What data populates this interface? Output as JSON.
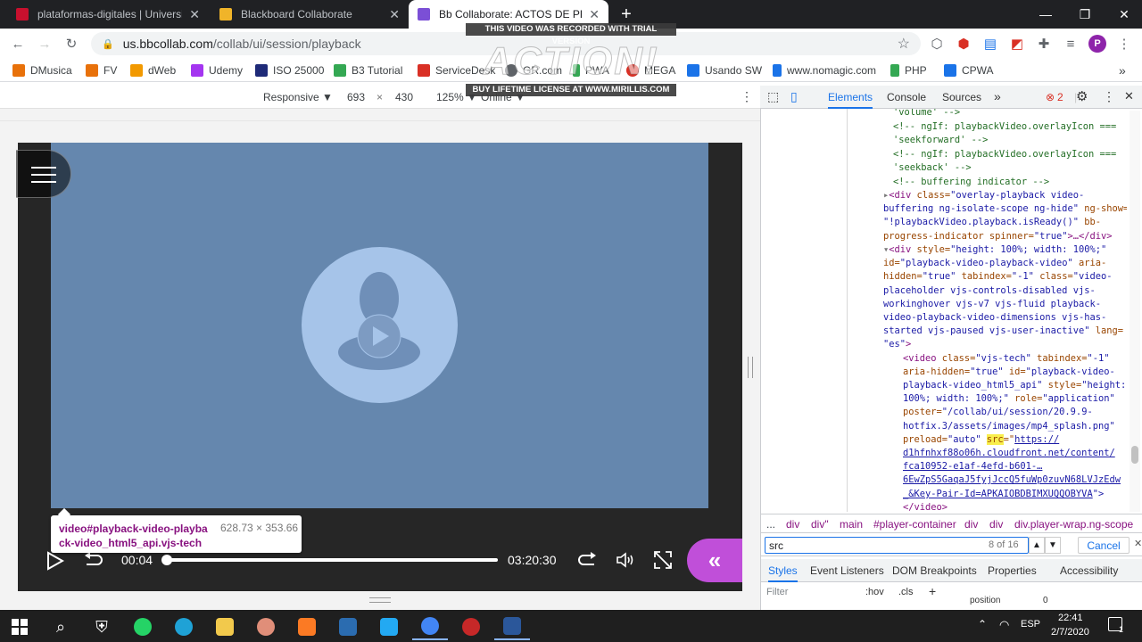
{
  "browser": {
    "tabs": [
      {
        "title": "plataformas-digitales | Universidad",
        "favicon_color": "#c8102e",
        "active": false
      },
      {
        "title": "Blackboard Collaborate",
        "favicon_color": "#f0b429",
        "active": false
      },
      {
        "title": "Bb Collaborate: ACTOS DE PRUEBA",
        "favicon_color": "#7b4fd6",
        "active": true
      }
    ],
    "new_tab": "+",
    "window_controls": {
      "minimize": "—",
      "maximize": "❐",
      "close": "✕"
    },
    "url_host": "us.bbcollab.com",
    "url_path": "/collab/ui/session/playback",
    "profile_initial": "P"
  },
  "bookmarks": [
    {
      "label": "DMusica",
      "color": "#e8710a"
    },
    {
      "label": "FV",
      "color": "#e8710a"
    },
    {
      "label": "dWeb",
      "color": "#f29900"
    },
    {
      "label": "Udemy",
      "color": "#a435f0"
    },
    {
      "label": "ISO 25000",
      "color": "#1e2a78"
    },
    {
      "label": "B3 Tutorial",
      "color": "#34a853"
    },
    {
      "label": "ServiceDesk",
      "color": "#d93025"
    },
    {
      "label": "GR.com",
      "color": "#5f6368"
    },
    {
      "label": "PWA",
      "color": "#34a853"
    },
    {
      "label": "MEGA",
      "color": "#d93025"
    },
    {
      "label": "Usando SW",
      "color": "#1a73e8"
    },
    {
      "label": "www.nomagic.com",
      "color": "#1a73e8"
    },
    {
      "label": "PHP",
      "color": "#34a853"
    },
    {
      "label": "CPWA",
      "color": "#1a73e8"
    }
  ],
  "device_toolbar": {
    "mode": "Responsive ▼",
    "width": "693",
    "times": "×",
    "height": "430",
    "zoom": "125% ▼",
    "network": "Online ▼"
  },
  "player": {
    "time_current": "00:04",
    "time_total": "03:20:30",
    "progress_fraction": 0.0,
    "tooltip_selector": "video#playback-video-playback-video_html5_api.vjs-tech",
    "tooltip_selector_line1": "video#playback-video-playba",
    "tooltip_selector_line2": "ck-video_html5_api.vjs-tech",
    "tooltip_size": "628.73 × 353.66",
    "video_bg_color": "#6587ae",
    "accent_color": "#c04fd9"
  },
  "devtools": {
    "tabs": [
      "Elements",
      "Console",
      "Sources",
      "»"
    ],
    "error_count": "2",
    "breadcrumbs": [
      "...",
      "div",
      "div\"",
      "main",
      "#player-container",
      "div",
      "div",
      "div.player-wrap.ng-scope"
    ],
    "search_value": "src",
    "search_count": "8 of 16",
    "search_cancel": "Cancel",
    "styles_tabs": [
      "Styles",
      "Event Listeners",
      "DOM Breakpoints",
      "Properties",
      "Accessibility"
    ],
    "filter_placeholder": "Filter",
    "filter_hov": ":hov",
    "filter_cls": ".cls",
    "filter_add": "+",
    "computed_prop": "position",
    "computed_value": "0",
    "code": {
      "l1": "'volume' -->",
      "l2": "<!-- ngIf: playbackVideo.overlayIcon ===",
      "l3": "'seekforward' -->",
      "l4": "<!-- ngIf: playbackVideo.overlayIcon ===",
      "l5": "'seekback' -->",
      "l6": "<!-- buffering indicator -->",
      "l7a": "<div",
      "l7b": " class=",
      "l7c": "\"overlay-playback video-",
      "l8": "buffering ng-isolate-scope ng-hide\"",
      "l8b": " ng-show=",
      "l9": "\"!playbackVideo.playback.isReady()\"",
      "l9b": " bb-",
      "l10": "progress-indicator",
      "l10b": " spinner=",
      "l10c": "\"true\"",
      "l10d": ">…</div>",
      "l11a": "<div",
      "l11b": " style=",
      "l11c": "\"height: 100%; width: 100%;\"",
      "l12": "id=",
      "l12b": "\"playback-video-playback-video\"",
      "l12c": " aria-",
      "l13": "hidden=",
      "l13b": "\"true\"",
      "l13c": " tabindex=",
      "l13d": "\"-1\"",
      "l13e": " class=",
      "l13f": "\"video-",
      "l14": "placeholder vjs-controls-disabled vjs-",
      "l15": "workinghover vjs-v7 vjs-fluid playback-",
      "l16": "video-playback-video-dimensions vjs-has-",
      "l17": "started vjs-paused vjs-user-inactive\"",
      "l17b": " lang=",
      "l18": "\"es\"",
      "l18b": ">",
      "l19a": "<video",
      "l19b": " class=",
      "l19c": "\"vjs-tech\"",
      "l19d": " tabindex=",
      "l19e": "\"-1\"",
      "l20": "aria-hidden=",
      "l20b": "\"true\"",
      "l20c": " id=",
      "l20d": "\"playback-video-",
      "l21": "playback-video_html5_api\"",
      "l21b": " style=",
      "l21c": "\"height:",
      "l22": "100%; width: 100%;\"",
      "l22b": " role=",
      "l22c": "\"application\"",
      "l23": "poster=",
      "l23b": "\"/collab/ui/session/20.9.9-",
      "l24": "hotfix.3/assets/images/mp4_splash.png\"",
      "l25": "preload=",
      "l25b": "\"auto\"",
      "l25c": "src",
      "l25d": "=\"",
      "l25e": "https://",
      "l26": "d1hfnhxf88o06h.cloudfront.net/content/",
      "l27": "fca10952-e1af-4efd-b601-…",
      "l28": "6EwZpS5GaqaJ5fyjJccQ5fuWp0zuvN68LVJzEdw",
      "l29": "_&Key-Pair-Id=APKAIOBDBIMXUQQOBYVA",
      "l29b": "\">",
      "l30": "</video>"
    }
  },
  "watermark": {
    "top": "THIS VIDEO WAS RECORDED WITH TRIAL VERSION",
    "logo": "ACTION!",
    "bottom": "BUY LIFETIME LICENSE AT WWW.MIRILLIS.COM"
  },
  "taskbar": {
    "apps": [
      {
        "name": "windows",
        "color": "#ffffff"
      },
      {
        "name": "search",
        "color": "#ffffff"
      },
      {
        "name": "security",
        "color": "#ffffff"
      },
      {
        "name": "whatsapp",
        "color": "#25d366"
      },
      {
        "name": "edge",
        "color": "#1fa2d6"
      },
      {
        "name": "explorer",
        "color": "#f2c94c"
      },
      {
        "name": "paint",
        "color": "#e08e79"
      },
      {
        "name": "xampp",
        "color": "#fb7a24"
      },
      {
        "name": "tool",
        "color": "#2b6cb0"
      },
      {
        "name": "vscode",
        "color": "#23a9f2"
      },
      {
        "name": "chrome",
        "color": "#4285f4"
      },
      {
        "name": "app-a",
        "color": "#c62828"
      },
      {
        "name": "word",
        "color": "#2b579a"
      }
    ],
    "language": "ESP",
    "time": "22:41",
    "date": "2/7/2020",
    "notification_count": "1"
  }
}
